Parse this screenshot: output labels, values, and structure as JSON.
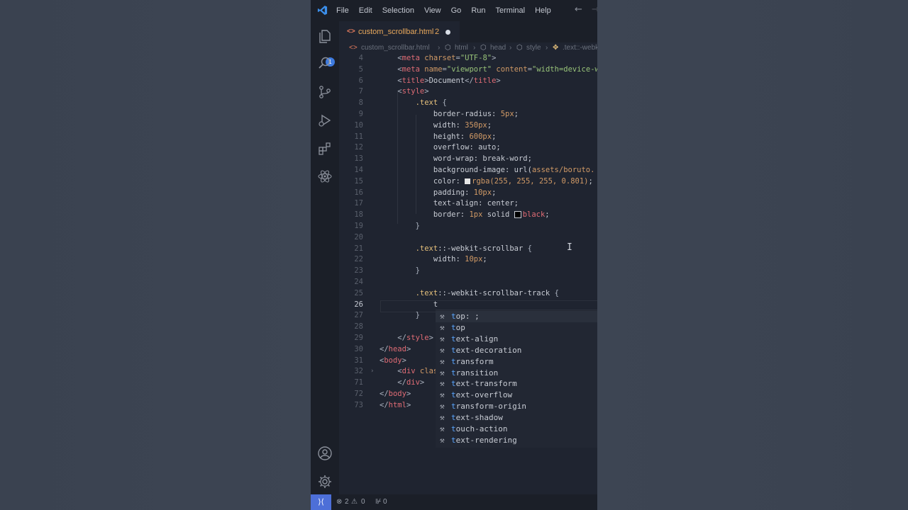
{
  "menu": [
    "File",
    "Edit",
    "Selection",
    "View",
    "Go",
    "Run",
    "Terminal",
    "Help"
  ],
  "activity_badge": "1",
  "tab": {
    "filename": "custom_scrollbar.html",
    "problems": "2"
  },
  "breadcrumb": [
    "custom_scrollbar.html",
    "html",
    "head",
    "style",
    ".text::-webk"
  ],
  "lines": [
    {
      "n": "4",
      "html": "        <span class='punct'>&lt;</span><span class='t'>meta</span> <span class='a'>charset</span><span class='punct'>=</span><span class='s'>\"UTF-8\"</span><span class='punct'>&gt;</span>"
    },
    {
      "n": "5",
      "html": "        <span class='punct'>&lt;</span><span class='t'>meta</span> <span class='a'>name</span><span class='punct'>=</span><span class='s'>\"viewport\"</span> <span class='a'>content</span><span class='punct'>=</span><span class='s'>\"width=device-w</span>"
    },
    {
      "n": "6",
      "html": "        <span class='punct'>&lt;</span><span class='t'>title</span><span class='punct'>&gt;</span>Document<span class='punct'>&lt;/</span><span class='t'>title</span><span class='punct'>&gt;</span>"
    },
    {
      "n": "7",
      "html": "        <span class='punct'>&lt;</span><span class='t'>style</span><span class='punct'>&gt;</span>"
    },
    {
      "n": "8",
      "html": "            <span class='sel'>.text</span> <span class='punct'>{</span>"
    },
    {
      "n": "9",
      "html": "                <span class='p'>border-radius</span>: <span class='num'>5px</span>;"
    },
    {
      "n": "10",
      "html": "                <span class='p'>width</span>: <span class='num'>350px</span>;"
    },
    {
      "n": "11",
      "html": "                <span class='p'>height</span>: <span class='num'>600px</span>;"
    },
    {
      "n": "12",
      "html": "                <span class='p'>overflow</span>: auto;"
    },
    {
      "n": "13",
      "html": "                <span class='p'>word-wrap</span>: break-word;"
    },
    {
      "n": "14",
      "html": "                <span class='p'>background-image</span>: url(<span class='num'>assets/boruto.</span>"
    },
    {
      "n": "15",
      "html": "                <span class='p'>color</span>: <span class='swatch' style='background:#e6e6e6'></span><span class='num'>rgba(255, 255, 255, 0.801)</span>;"
    },
    {
      "n": "16",
      "html": "                <span class='p'>padding</span>: <span class='num'>10px</span>;"
    },
    {
      "n": "17",
      "html": "                <span class='p'>text-align</span>: center;"
    },
    {
      "n": "18",
      "html": "                <span class='p'>border</span>: <span class='num'>1px</span> solid <span class='swatch' style='background:#000;border:1px solid #c8ccd4'></span><span class='t'>black</span>;"
    },
    {
      "n": "19",
      "html": "            <span class='punct'>}</span>"
    },
    {
      "n": "20",
      "html": ""
    },
    {
      "n": "21",
      "html": "            <span class='sel'>.text</span>::-webkit-scrollbar <span class='punct'>{</span>"
    },
    {
      "n": "22",
      "html": "                <span class='p'>width</span>: <span class='num'>10px</span>;"
    },
    {
      "n": "23",
      "html": "            <span class='punct'>}</span>"
    },
    {
      "n": "24",
      "html": ""
    },
    {
      "n": "25",
      "html": "            <span class='sel'>.text</span>::-webkit-scrollbar-track <span class='punct'>{</span>"
    },
    {
      "n": "26",
      "html": "                t"
    },
    {
      "n": "27",
      "html": "            <span class='punct'>}</span>"
    },
    {
      "n": "28",
      "html": ""
    },
    {
      "n": "29",
      "html": "        <span class='punct'>&lt;/</span><span class='t'>style</span><span class='punct'>&gt;</span>"
    },
    {
      "n": "30",
      "html": "    <span class='punct'>&lt;/</span><span class='t'>head</span><span class='punct'>&gt;</span>"
    },
    {
      "n": "31",
      "html": "    <span class='punct'>&lt;</span><span class='t'>body</span><span class='punct'>&gt;</span>"
    },
    {
      "n": "32",
      "html": "        <span class='punct'>&lt;</span><span class='t'>div</span> <span class='a'>clas</span>"
    },
    {
      "n": "71",
      "html": "        <span class='punct'>&lt;/</span><span class='t'>div</span><span class='punct'>&gt;</span>"
    },
    {
      "n": "72",
      "html": "    <span class='punct'>&lt;/</span><span class='t'>body</span><span class='punct'>&gt;</span>"
    },
    {
      "n": "73",
      "html": "    <span class='punct'>&lt;/</span><span class='t'>html</span><span class='punct'>&gt;</span>"
    }
  ],
  "suggestions": [
    {
      "typed": "t",
      "rest": "op: ;"
    },
    {
      "typed": "t",
      "rest": "op"
    },
    {
      "typed": "t",
      "rest": "ext-align"
    },
    {
      "typed": "t",
      "rest": "ext-decoration"
    },
    {
      "typed": "t",
      "rest": "ransform"
    },
    {
      "typed": "t",
      "rest": "ransition"
    },
    {
      "typed": "t",
      "rest": "ext-transform"
    },
    {
      "typed": "t",
      "rest": "ext-overflow"
    },
    {
      "typed": "t",
      "rest": "ransform-origin"
    },
    {
      "typed": "t",
      "rest": "ext-shadow"
    },
    {
      "typed": "t",
      "rest": "ouch-action"
    },
    {
      "typed": "t",
      "rest": "ext-rendering"
    }
  ],
  "status": {
    "errors": "2",
    "warnings": "0",
    "ports": "0"
  },
  "colors": {
    "editor_bg": "#1f2430",
    "accent": "#4d6fd8",
    "tag": "#e06c75",
    "string": "#98c379",
    "number": "#d19a66"
  }
}
